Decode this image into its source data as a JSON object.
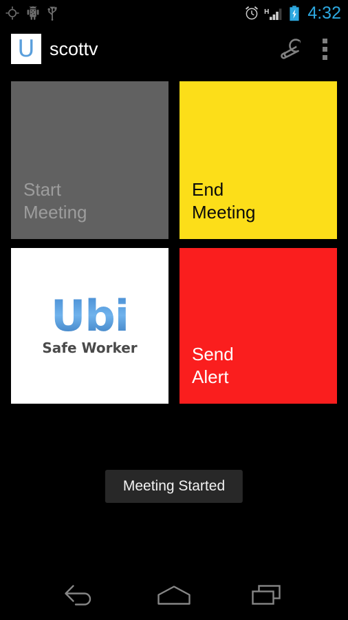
{
  "status_bar": {
    "left_icons": [
      {
        "name": "gps-location-icon",
        "label": "GPS"
      },
      {
        "name": "android-debug-icon",
        "label": "ADB"
      },
      {
        "name": "usb-icon",
        "label": "USB"
      }
    ],
    "alarm_icon": "alarm-clock-icon",
    "network_type": "H",
    "signal_icon": "signal-bars-icon",
    "battery_icon": "battery-charging-icon",
    "clock": "4:32",
    "clock_color": "#2da8e0"
  },
  "action_bar": {
    "logo_letter": "U",
    "title": "scottv",
    "settings_icon": "wrench-icon",
    "overflow_icon": "overflow-menu-icon"
  },
  "tiles": [
    {
      "id": "start-meeting",
      "label": "Start\nMeeting",
      "bg": "#616161",
      "fg": "#9d9d9d",
      "enabled": false
    },
    {
      "id": "end-meeting",
      "label": "End\nMeeting",
      "bg": "#fcde19",
      "fg": "#0b0b0b",
      "enabled": true
    },
    {
      "id": "ubi-logo",
      "logo_text": "Ubi",
      "logo_subtitle": "Safe Worker",
      "bg": "#ffffff",
      "fg": "#4a8fd4",
      "enabled": false
    },
    {
      "id": "send-alert",
      "label": "Send\nAlert",
      "bg": "#fa1e1e",
      "fg": "#ffffff",
      "enabled": true
    }
  ],
  "toast": {
    "message": "Meeting Started"
  },
  "nav_bar": {
    "back_icon": "back-arrow-icon",
    "home_icon": "home-icon",
    "recents_icon": "recent-apps-icon"
  }
}
